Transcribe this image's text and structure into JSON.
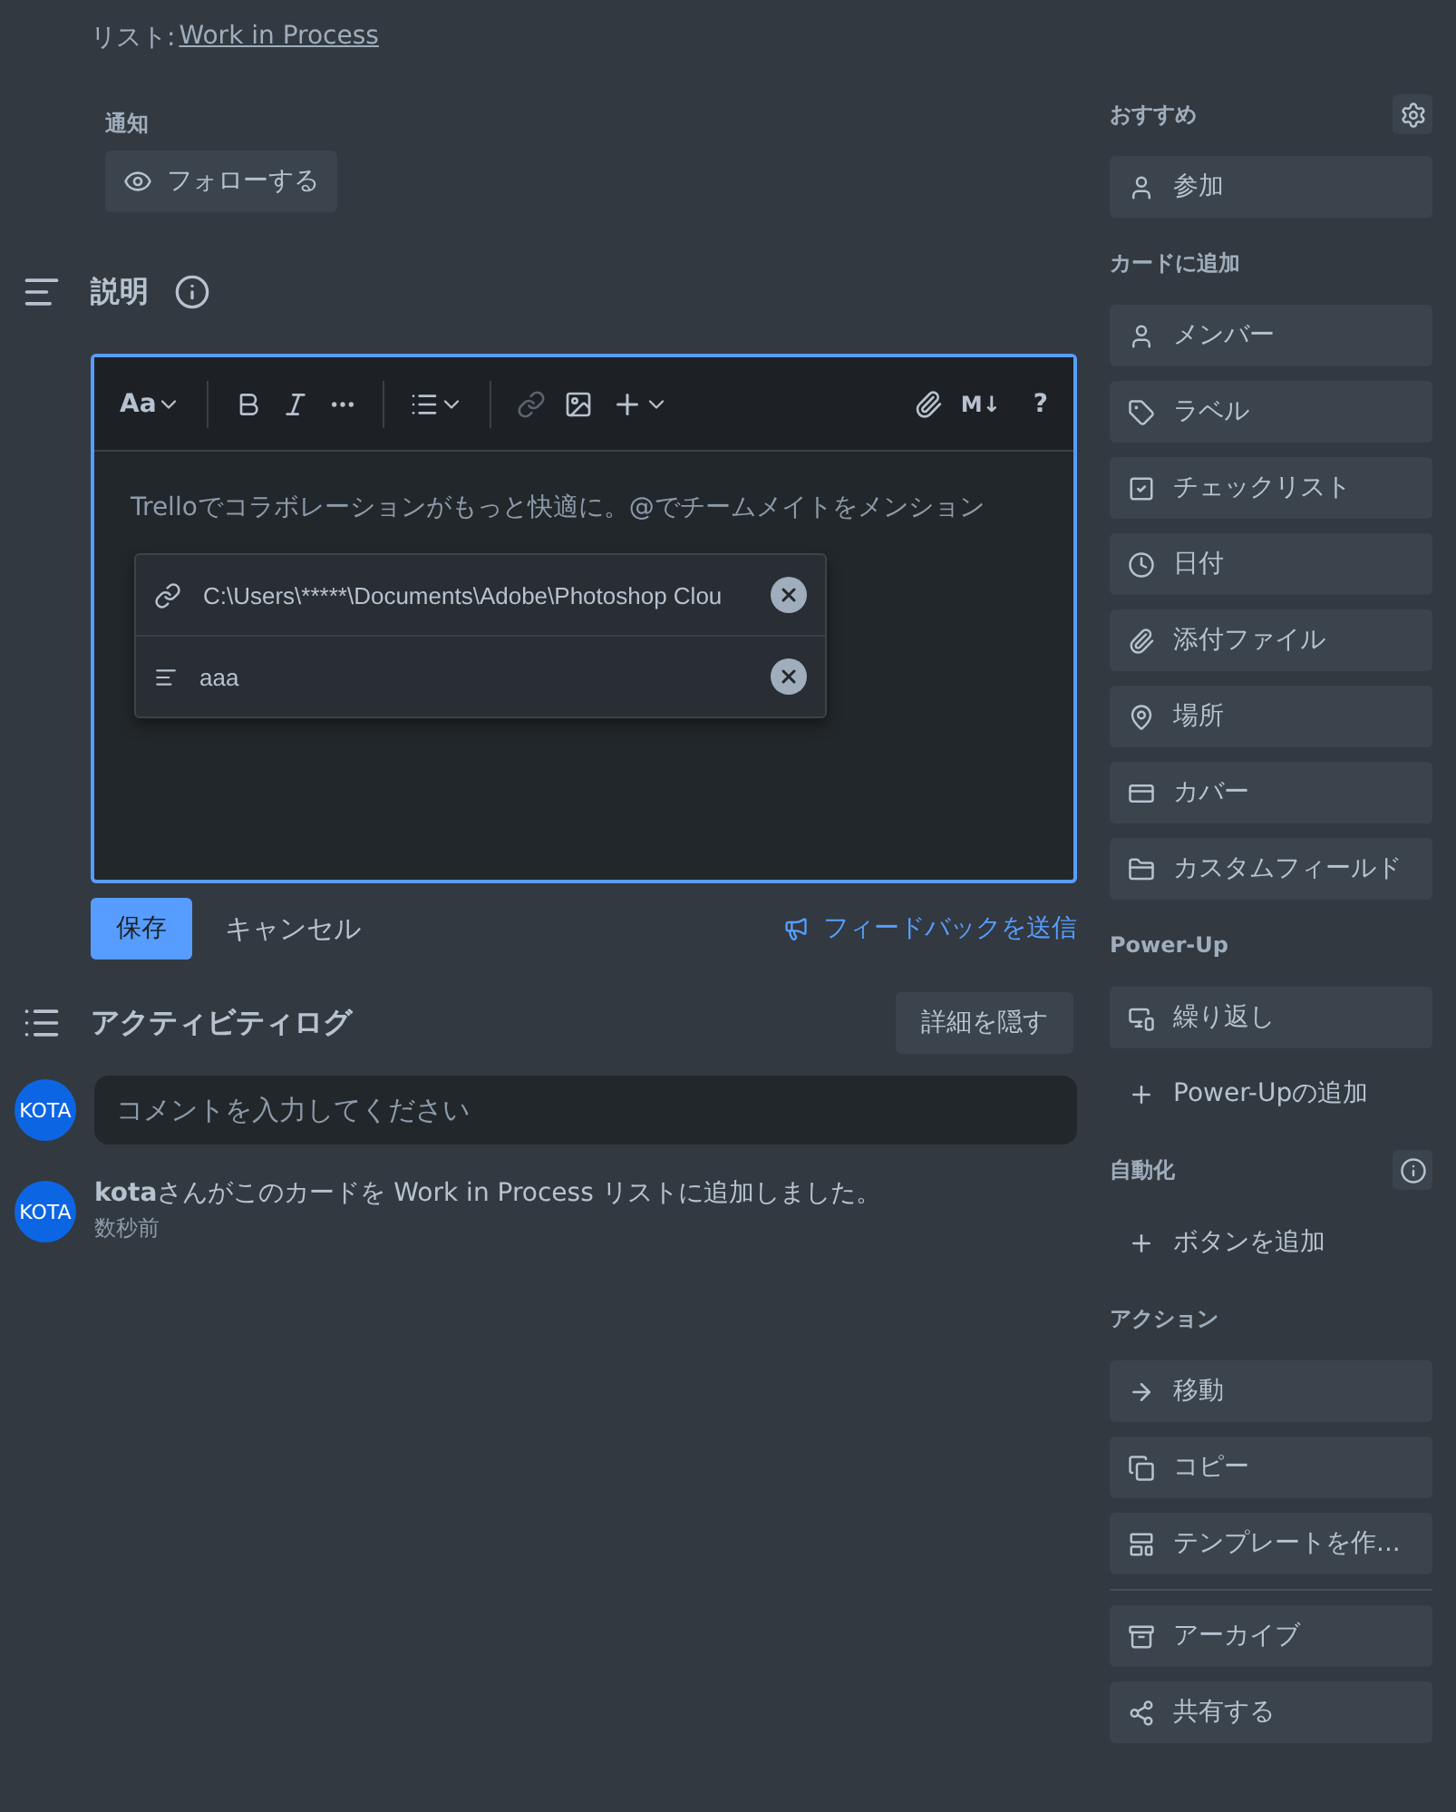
{
  "list_line": {
    "label": "リスト:",
    "link": "Work in Process"
  },
  "notifications": {
    "title": "通知",
    "follow_button": "フォローする"
  },
  "description": {
    "title": "説明",
    "toolbar": {
      "font_button": "Aa",
      "markdown_button": "M↓",
      "help_button": "?",
      "link_disabled": true
    },
    "placeholder": "Trelloでコラボレーションがもっと快適に。@でチームメイトをメンション",
    "link_popup": {
      "url": "C:\\Users\\*****\\Documents\\Adobe\\Photoshop Clou",
      "text": "aaa"
    },
    "save_button": "保存",
    "cancel_button": "キャンセル",
    "feedback_link": "フィードバックを送信"
  },
  "activity": {
    "title": "アクティビティログ",
    "toggle_button": "詳細を隠す",
    "comment": {
      "avatar": "KOTA",
      "placeholder": "コメントを入力してください"
    },
    "entries": [
      {
        "avatar": "KOTA",
        "text": "**kota**さんがこのカードを Work in Process リストに追加しました。",
        "time": "数秒前"
      }
    ]
  },
  "sidebar": [
    {
      "title": "おすすめ",
      "items": [
        {
          "label": "参加",
          "kind": "button"
        }
      ]
    },
    {
      "title": "カードに追加",
      "items": [
        {
          "label": "メンバー",
          "kind": "button"
        },
        {
          "label": "ラベル",
          "kind": "button"
        },
        {
          "label": "チェックリスト",
          "kind": "button"
        },
        {
          "label": "日付",
          "kind": "button"
        },
        {
          "label": "添付ファイル",
          "kind": "button"
        },
        {
          "label": "場所",
          "kind": "button"
        },
        {
          "label": "カバー",
          "kind": "button"
        },
        {
          "label": "カスタムフィールド",
          "kind": "button"
        }
      ]
    },
    {
      "title": "Power-Up",
      "items": [
        {
          "label": "繰り返し",
          "kind": "button"
        },
        {
          "label": "Power-Upの追加",
          "kind": "plain"
        }
      ]
    },
    {
      "title": "自動化",
      "items": [
        {
          "label": "ボタンを追加",
          "kind": "plain"
        }
      ]
    },
    {
      "title": "アクション",
      "items": [
        {
          "label": "移動",
          "kind": "button"
        },
        {
          "label": "コピー",
          "kind": "button"
        },
        {
          "label": "テンプレートを作...",
          "kind": "button"
        },
        {
          "label": "アーカイブ",
          "kind": "button",
          "separated": true
        },
        {
          "label": "共有する",
          "kind": "button"
        }
      ]
    }
  ]
}
